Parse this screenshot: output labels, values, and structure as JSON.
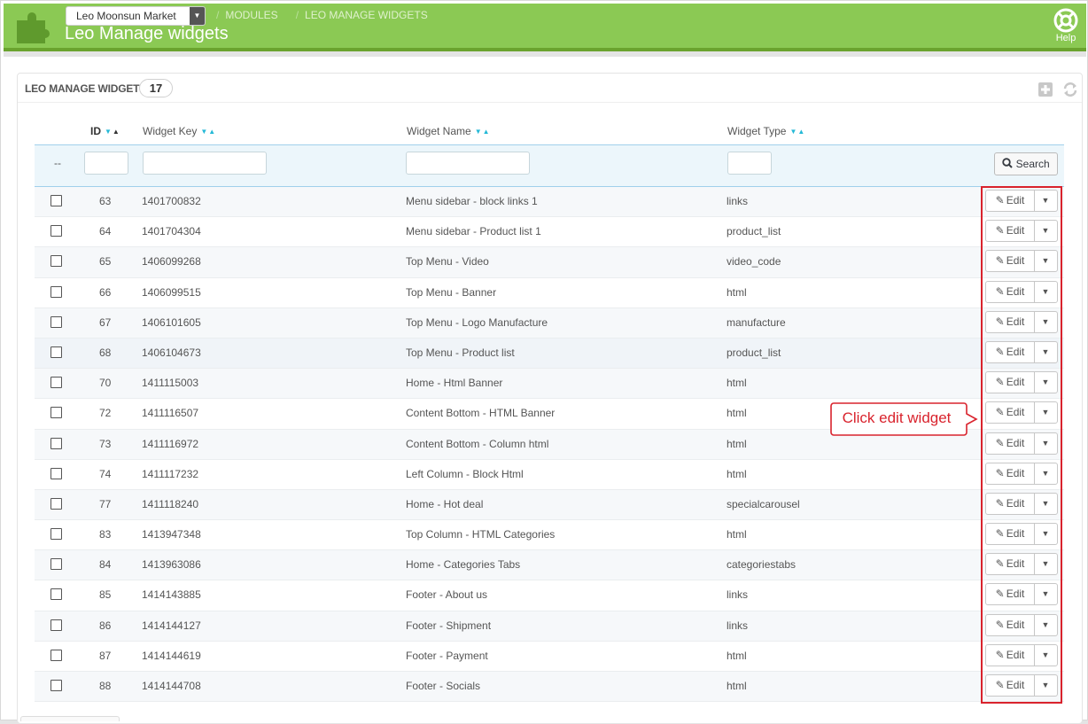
{
  "header": {
    "shop_name": "Leo Moonsun Market",
    "breadcrumb": [
      "MODULES",
      "LEO MANAGE WIDGETS"
    ],
    "title": "Leo Manage widgets",
    "help_label": "Help"
  },
  "panel": {
    "title": "LEO MANAGE WIDGETS",
    "count": "17"
  },
  "table": {
    "columns": {
      "id": "ID",
      "widget_key": "Widget Key",
      "widget_name": "Widget Name",
      "widget_type": "Widget Type"
    },
    "filter_placeholder": "--",
    "search_label": "Search",
    "edit_label": "Edit",
    "rows": [
      {
        "id": "63",
        "key": "1401700832",
        "name": "Menu sidebar - block links 1",
        "type": "links"
      },
      {
        "id": "64",
        "key": "1401704304",
        "name": "Menu sidebar - Product list 1",
        "type": "product_list"
      },
      {
        "id": "65",
        "key": "1406099268",
        "name": "Top Menu - Video",
        "type": "video_code"
      },
      {
        "id": "66",
        "key": "1406099515",
        "name": "Top Menu - Banner",
        "type": "html"
      },
      {
        "id": "67",
        "key": "1406101605",
        "name": "Top Menu - Logo Manufacture",
        "type": "manufacture"
      },
      {
        "id": "68",
        "key": "1406104673",
        "name": "Top Menu - Product list",
        "type": "product_list"
      },
      {
        "id": "70",
        "key": "1411115003",
        "name": "Home - Html Banner",
        "type": "html"
      },
      {
        "id": "72",
        "key": "1411116507",
        "name": "Content Bottom - HTML Banner",
        "type": "html"
      },
      {
        "id": "73",
        "key": "1411116972",
        "name": "Content Bottom - Column html",
        "type": "html"
      },
      {
        "id": "74",
        "key": "1411117232",
        "name": "Left Column - Block Html",
        "type": "html"
      },
      {
        "id": "77",
        "key": "1411118240",
        "name": "Home - Hot deal",
        "type": "specialcarousel"
      },
      {
        "id": "83",
        "key": "1413947348",
        "name": "Top Column - HTML Categories",
        "type": "html"
      },
      {
        "id": "84",
        "key": "1413963086",
        "name": "Home - Categories Tabs",
        "type": "categoriestabs"
      },
      {
        "id": "85",
        "key": "1414143885",
        "name": "Footer - About us",
        "type": "links"
      },
      {
        "id": "86",
        "key": "1414144127",
        "name": "Footer - Shipment",
        "type": "links"
      },
      {
        "id": "87",
        "key": "1414144619",
        "name": "Footer - Payment",
        "type": "html"
      },
      {
        "id": "88",
        "key": "1414144708",
        "name": "Footer - Socials",
        "type": "html"
      }
    ]
  },
  "annotation": {
    "callout_text": "Click edit widget",
    "color": "#d9232d"
  },
  "colors": {
    "header_green": "#8bc954",
    "sort_arrow": "#25b9d7",
    "filter_bg": "#ecf6fb"
  }
}
